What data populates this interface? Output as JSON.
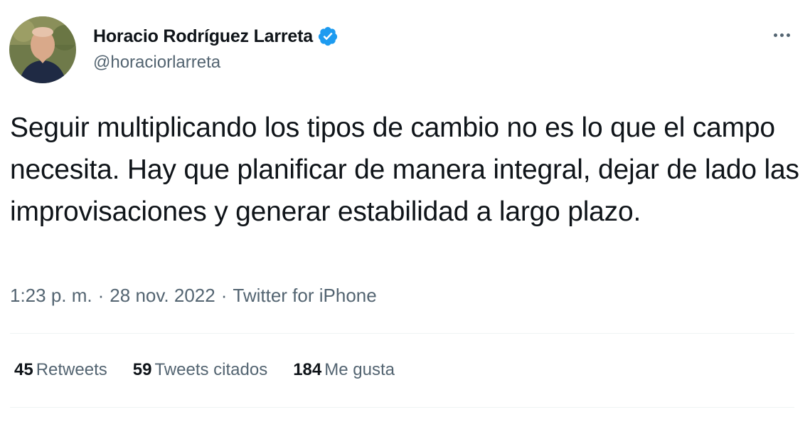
{
  "author": {
    "name": "Horacio Rodríguez Larreta",
    "handle": "@horaciorlarreta",
    "verified": true,
    "verified_color": "#1d9bf0"
  },
  "tweet": {
    "text": "Seguir multiplicando los tipos de cambio no es lo que el campo necesita. Hay que planificar de manera integral, dejar de lado las improvisaciones y generar estabilidad a largo plazo.",
    "time": "1:23 p. m.",
    "date": "28 nov. 2022",
    "separator": "·",
    "source": "Twitter for iPhone"
  },
  "stats": {
    "retweets": {
      "count": "45",
      "label": "Retweets"
    },
    "quotes": {
      "count": "59",
      "label": "Tweets citados"
    },
    "likes": {
      "count": "184",
      "label": "Me gusta"
    }
  },
  "icons": {
    "more": "more-horizontal-icon",
    "verified": "verified-badge-icon"
  }
}
